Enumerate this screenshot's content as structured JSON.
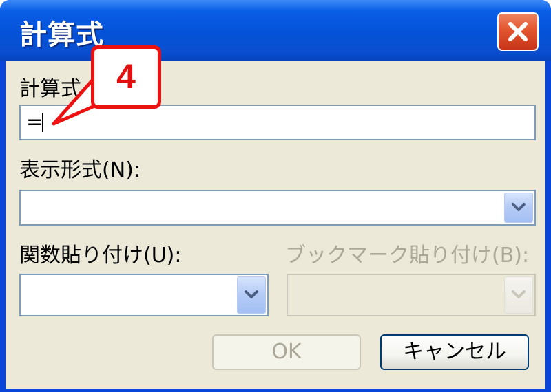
{
  "window": {
    "title": "計算式",
    "close_icon": "close-icon"
  },
  "formula": {
    "label": "計算式",
    "value": "="
  },
  "number_format": {
    "label": "表示形式(N):",
    "value": ""
  },
  "paste_function": {
    "label": "関数貼り付け(U):",
    "value": ""
  },
  "paste_bookmark": {
    "label": "ブックマーク貼り付け(B):",
    "value": ""
  },
  "buttons": {
    "ok_label": "OK",
    "cancel_label": "キャンセル"
  },
  "callout": {
    "number": "4"
  },
  "colors": {
    "titlebar": "#0552d8",
    "close_button": "#e2552e",
    "dialog_face": "#ece9d8",
    "callout_accent": "#ee1111"
  }
}
